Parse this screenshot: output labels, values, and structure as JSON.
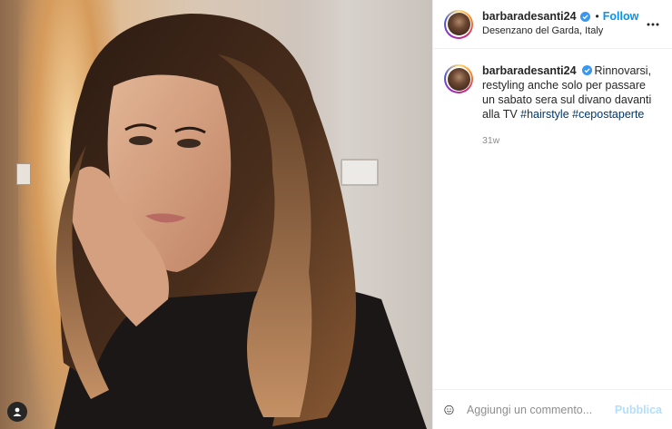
{
  "post": {
    "username": "barbaradesanti24",
    "follow_label": "Follow",
    "separator": "•",
    "location": "Desenzano del Garda, Italy",
    "caption_text": "Rinnovarsi, restyling anche solo per passare un sabato sera sul divano davanti alla TV ",
    "hashtags": [
      "#hairstyle",
      "#cepostaperte"
    ],
    "age": "31w",
    "verified": true
  },
  "comment": {
    "placeholder": "Aggiungi un commento...",
    "publish_label": "Pubblica"
  },
  "icons": {
    "verified": "verified-badge-icon",
    "more": "more-options-icon",
    "emoji": "emoji-icon",
    "user": "user-tag-icon"
  },
  "colors": {
    "accent": "#0095f6",
    "hashtag": "#00376b",
    "publish_disabled": "#b2dffc",
    "muted": "#8e8e8e"
  }
}
